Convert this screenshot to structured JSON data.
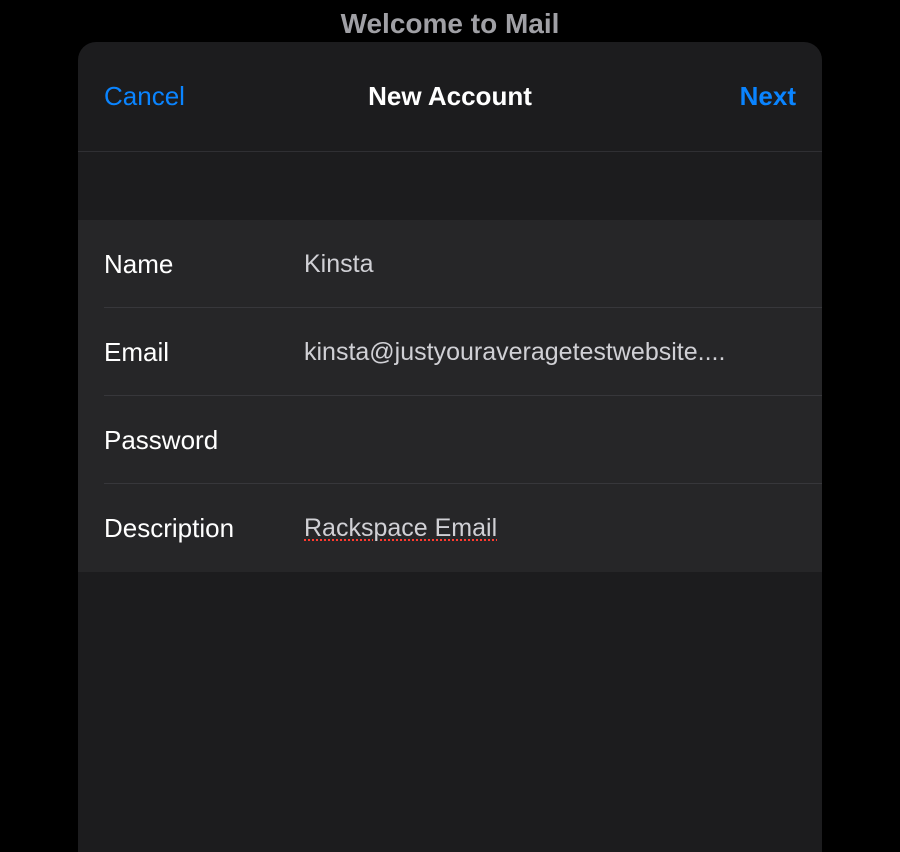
{
  "background": {
    "title": "Welcome to Mail"
  },
  "nav": {
    "cancel": "Cancel",
    "title": "New Account",
    "next": "Next"
  },
  "form": {
    "name": {
      "label": "Name",
      "value": "Kinsta"
    },
    "email": {
      "label": "Email",
      "value": "kinsta@justyouraveragetestwebsite...."
    },
    "password": {
      "label": "Password",
      "value": ""
    },
    "description": {
      "label": "Description",
      "value": "Rackspace Email"
    }
  }
}
